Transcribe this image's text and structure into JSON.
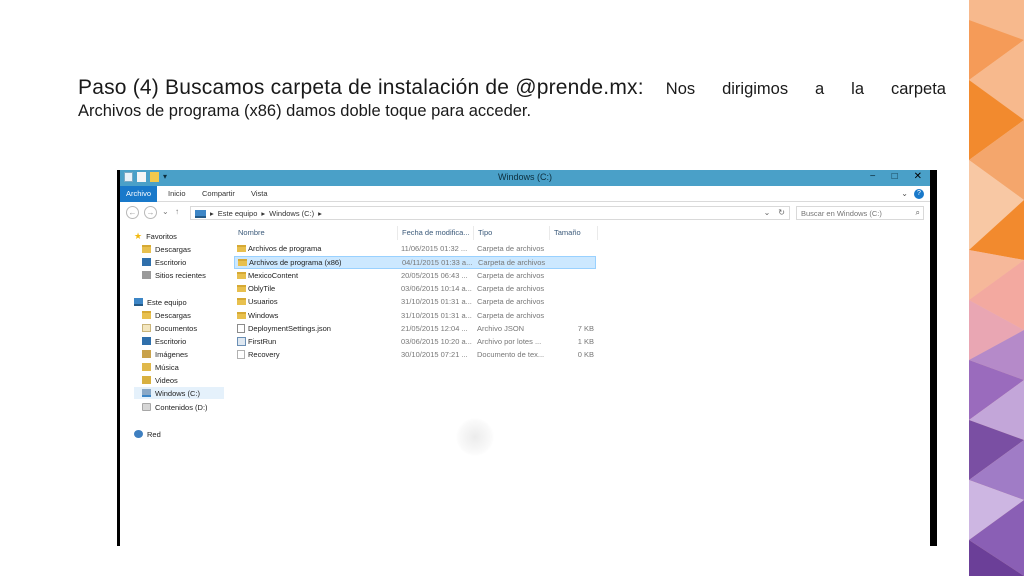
{
  "slide": {
    "heading": "Paso (4) Buscamos carpeta de instalación de @prende.mx:",
    "body_words": [
      "Nos",
      "dirigimos",
      "a",
      "la",
      "carpeta"
    ],
    "body_line2": "Archivos de programa (x86) damos doble toque para acceder."
  },
  "window": {
    "title": "Windows (C:)",
    "controls": {
      "minimize": "−",
      "maximize": "□",
      "close": "✕"
    },
    "tabs": [
      "Archivo",
      "Inicio",
      "Compartir",
      "Vista"
    ],
    "ribbon_expand": "⌄",
    "help": "?"
  },
  "address": {
    "back": "←",
    "forward": "→",
    "recent": "⌄",
    "up": "↑",
    "crumbs": [
      "Este equipo",
      "Windows (C:)"
    ],
    "separator": "▸",
    "dropdown": "⌄",
    "refresh": "↻",
    "search_placeholder": "Buscar en Windows (C:)",
    "search_glyph": "⌕"
  },
  "navpane": {
    "favorites_label": "Favoritos",
    "favorites": [
      {
        "label": "Descargas",
        "icon": "downloads-folder-icon"
      },
      {
        "label": "Escritorio",
        "icon": "desktop-icon"
      },
      {
        "label": "Sitios recientes",
        "icon": "recent-places-icon"
      }
    ],
    "pc_label": "Este equipo",
    "pc_items": [
      {
        "label": "Descargas",
        "icon": "downloads-folder-icon"
      },
      {
        "label": "Documentos",
        "icon": "documents-icon"
      },
      {
        "label": "Escritorio",
        "icon": "desktop-icon"
      },
      {
        "label": "Imágenes",
        "icon": "pictures-icon"
      },
      {
        "label": "Música",
        "icon": "music-icon"
      },
      {
        "label": "Videos",
        "icon": "videos-icon"
      },
      {
        "label": "Windows (C:)",
        "icon": "drive-icon"
      },
      {
        "label": "Contenidos (D:)",
        "icon": "dvd-drive-icon"
      }
    ],
    "network_label": "Red",
    "star_glyph": "★"
  },
  "files": {
    "columns": [
      "Nombre",
      "Fecha de modifica...",
      "Tipo",
      "Tamaño"
    ],
    "rows": [
      {
        "name": "Archivos de programa",
        "date": "11/06/2015 01:32 ...",
        "type": "Carpeta de archivos",
        "size": "",
        "kind": "folder"
      },
      {
        "name": "Archivos de programa (x86)",
        "date": "04/11/2015 01:33 a...",
        "type": "Carpeta de archivos",
        "size": "",
        "kind": "folder"
      },
      {
        "name": "MexicoContent",
        "date": "20/05/2015 06:43 ...",
        "type": "Carpeta de archivos",
        "size": "",
        "kind": "folder"
      },
      {
        "name": "OblyTile",
        "date": "03/06/2015 10:14 a...",
        "type": "Carpeta de archivos",
        "size": "",
        "kind": "folder"
      },
      {
        "name": "Usuarios",
        "date": "31/10/2015 01:31 a...",
        "type": "Carpeta de archivos",
        "size": "",
        "kind": "folder"
      },
      {
        "name": "Windows",
        "date": "31/10/2015 01:31 a...",
        "type": "Carpeta de archivos",
        "size": "",
        "kind": "folder"
      },
      {
        "name": "DeploymentSettings.json",
        "date": "21/05/2015 12:04 ...",
        "type": "Archivo JSON",
        "size": "7 KB",
        "kind": "file"
      },
      {
        "name": "FirstRun",
        "date": "03/06/2015 10:20 a...",
        "type": "Archivo por lotes ...",
        "size": "1 KB",
        "kind": "exe"
      },
      {
        "name": "Recovery",
        "date": "30/10/2015 07:21 ...",
        "type": "Documento de tex...",
        "size": "0 KB",
        "kind": "plain"
      }
    ],
    "selected_index": 1
  },
  "colors": {
    "titlebar": "#4aa0c8",
    "file_tab": "#1979ca",
    "selection": "#cce8ff",
    "deco_orange": "#f28a2e",
    "deco_purple": "#7a4fa3"
  }
}
